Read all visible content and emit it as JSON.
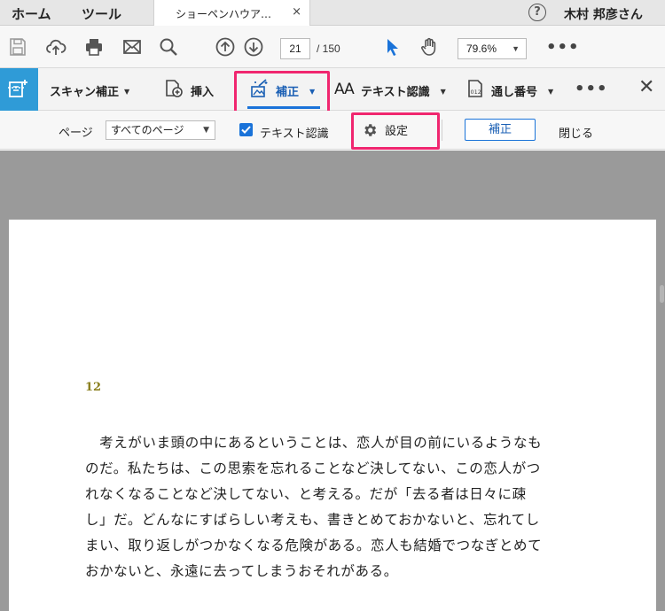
{
  "tabbar": {
    "home": "ホーム",
    "tools": "ツール",
    "doc_title": "ショーペンハウア…",
    "close": "×",
    "help": "?",
    "user": "木村 邦彦さん"
  },
  "toolbar": {
    "icons": [
      "save-icon",
      "upload-icon",
      "print-icon",
      "mail-icon",
      "search-icon",
      "page-up-icon",
      "page-down-icon",
      "select-cursor-icon",
      "hand-icon"
    ],
    "page_current": "21",
    "page_total": "/ 150",
    "zoom": "79.6%",
    "more": "•••"
  },
  "scan": {
    "scan_correct": "スキャン補正",
    "insert": "挿入",
    "correct": "補正",
    "text_recognition": "テキスト認識",
    "bates_number": "通し番号",
    "more": "•••",
    "close": "✕",
    "accent": "#1a73d9",
    "highlight": "#f0266f"
  },
  "options": {
    "page_label": "ページ",
    "page_select": "すべてのページ",
    "text_recognition_check": "テキスト認識",
    "text_recognition_checked": true,
    "settings": "設定",
    "correct_button": "補正",
    "close_button": "閉じる"
  },
  "document": {
    "page_number": "12",
    "lines": [
      "　考えがいま頭の中にあるということは、恋人が目の前にいるようなも",
      "のだ。私たちは、この思索を忘れることなど決してない、この恋人がつ",
      "れなくなることなど決してない、と考える。だが「去る者は日々に疎",
      "し」だ。どんなにすばらしい考えも、書きとめておかないと、忘れてし",
      "まい、取り返しがつかなくなる危険がある。恋人も結婚でつなぎとめて",
      "おかないと、永遠に去ってしまうおそれがある。"
    ]
  }
}
